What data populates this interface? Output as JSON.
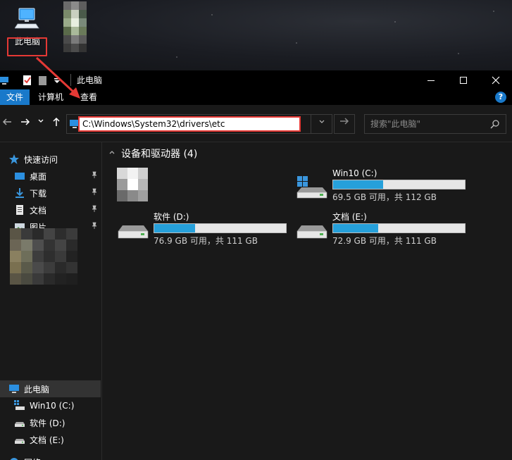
{
  "desktop": {
    "computer_icon_label": "此电脑"
  },
  "window": {
    "title": "此电脑",
    "controls": {
      "minimize": "—",
      "maximize": "☐",
      "close": "✕"
    }
  },
  "ribbon": {
    "tabs": [
      "文件",
      "计算机",
      "查看"
    ],
    "help": "?"
  },
  "address_bar": {
    "path": "C:\\Windows\\System32\\drivers\\etc",
    "search_placeholder": "搜索\"此电脑\""
  },
  "sidebar": {
    "quick_access": "快速访问",
    "items": [
      {
        "label": "桌面",
        "icon": "desktop-folder-icon"
      },
      {
        "label": "下载",
        "icon": "download-folder-icon"
      },
      {
        "label": "文档",
        "icon": "document-folder-icon"
      },
      {
        "label": "图片",
        "icon": "picture-folder-icon"
      }
    ],
    "this_pc": "此电脑",
    "drives": [
      "Win10 (C:)",
      "软件 (D:)",
      "文档 (E:)"
    ],
    "network": "网络"
  },
  "main": {
    "group_title": "设备和驱动器 (4)",
    "drives": [
      {
        "name": "Win10 (C:)",
        "info": "69.5 GB 可用，共 112 GB",
        "used_fraction": 0.38,
        "os": true
      },
      {
        "name": "软件 (D:)",
        "info": "76.9 GB 可用，共 111 GB",
        "used_fraction": 0.31,
        "os": false
      },
      {
        "name": "文档 (E:)",
        "info": "72.9 GB 可用，共 111 GB",
        "used_fraction": 0.34,
        "os": false
      }
    ]
  },
  "colors": {
    "accent": "#1979ca",
    "drive_bar": "#26a0da",
    "annotation_red": "#e53935"
  }
}
